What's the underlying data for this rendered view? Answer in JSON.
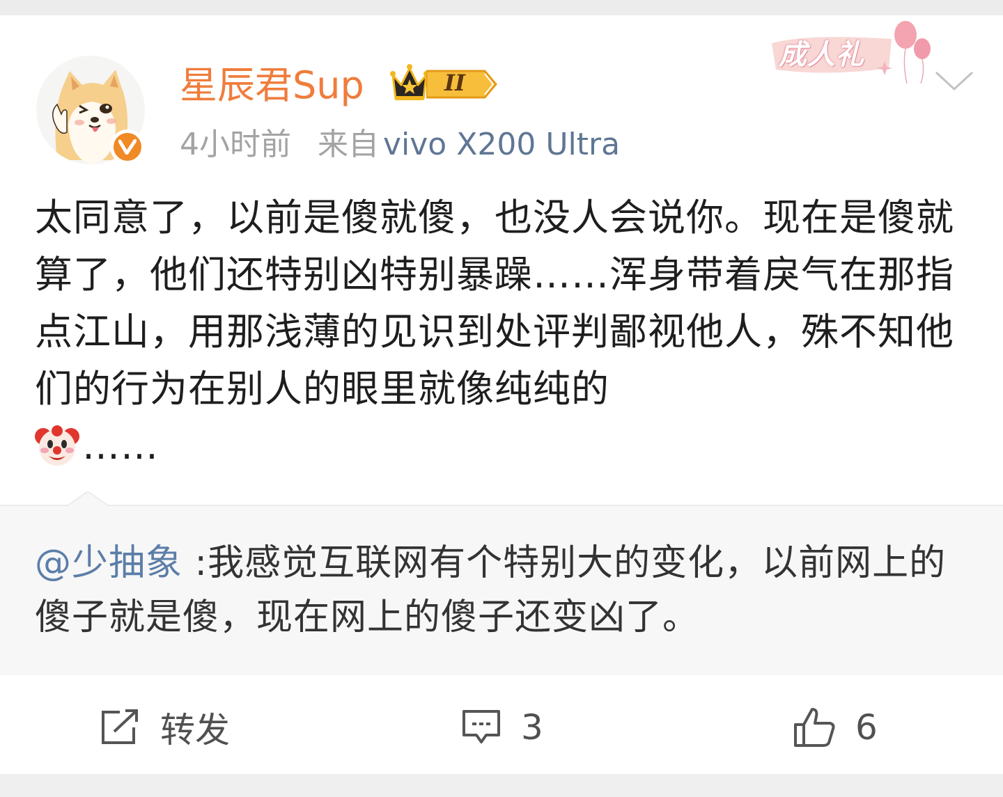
{
  "header": {
    "username": "星辰君Sup",
    "level": "II",
    "time": "4小时前",
    "source_label": "来自",
    "device": "vivo X200 Ultra",
    "decoration_text": "成人礼"
  },
  "post": {
    "text": "太同意了，以前是傻就傻，也没人会说你。现在是傻就算了，他们还特别凶特别暴躁……浑身带着戾气在那指点江山，用那浅薄的见识到处评判鄙视他人，殊不知他们的行为在别人的眼里就像纯纯的",
    "trailing": "……",
    "emoji": "clown-face"
  },
  "quote": {
    "mention": "@少抽象",
    "text": ":我感觉互联网有个特别大的变化，以前网上的傻子就是傻，现在网上的傻子还变凶了。"
  },
  "actions": {
    "repost_label": "转发",
    "comment_count": "3",
    "like_count": "6"
  },
  "colors": {
    "username": "#ef7d3c",
    "device_link": "#5f7694",
    "mention": "#5b7ea8",
    "verified_badge": "#f08a25"
  }
}
